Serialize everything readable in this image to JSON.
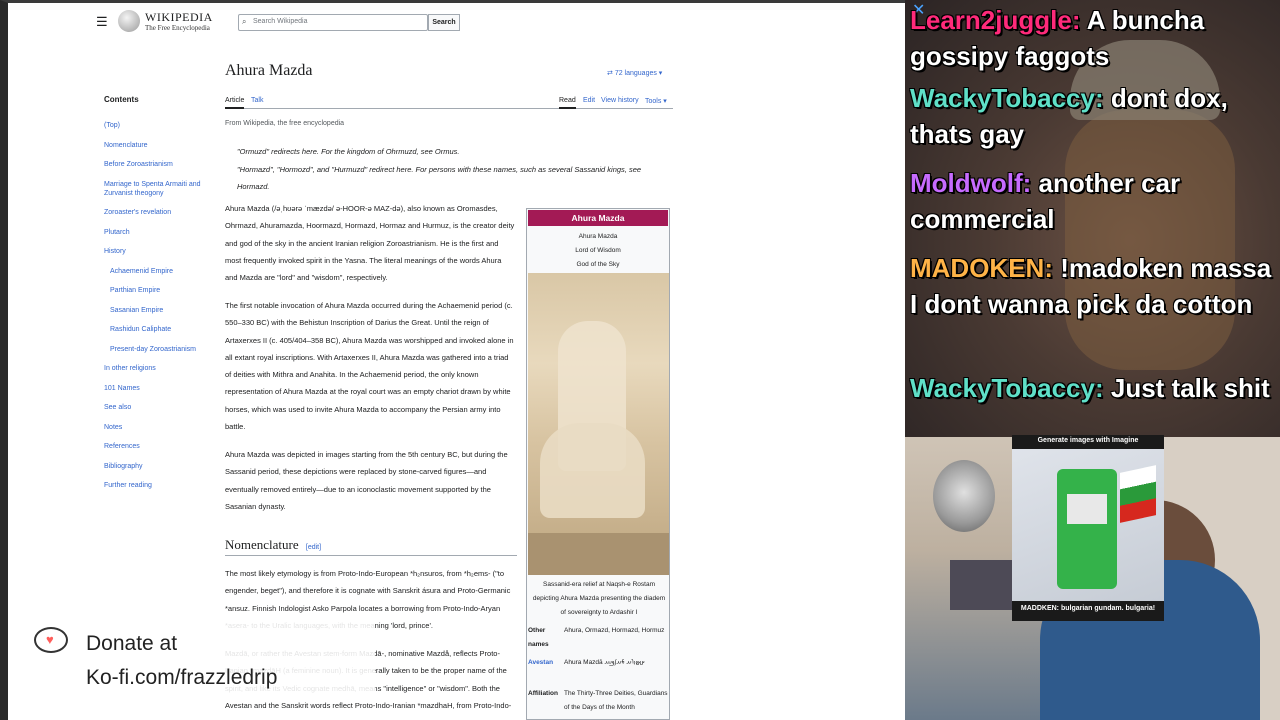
{
  "wiki": {
    "wordmark": "WIKIPEDIA",
    "tagline": "The Free Encyclopedia",
    "search_placeholder": "Search Wikipedia",
    "search_button": "Search",
    "title": "Ahura Mazda",
    "languages": "72 languages",
    "tabs": {
      "article": "Article",
      "talk": "Talk",
      "read": "Read",
      "edit": "Edit",
      "history": "View history",
      "tools": "Tools"
    },
    "from": "From Wikipedia, the free encyclopedia",
    "hatnote1": "\"Ormuzd\" redirects here. For the kingdom of Ohrmuzd, see Ormus.",
    "hatnote2": "\"Hormazd\", \"Hormozd\", and \"Hurmuzd\" redirect here. For persons with these names, such as several Sassanid kings, see Hormazd.",
    "toc_title": "Contents",
    "toc": [
      {
        "label": "(Top)",
        "sub": false
      },
      {
        "label": "Nomenclature",
        "sub": false
      },
      {
        "label": "Before Zoroastrianism",
        "sub": false
      },
      {
        "label": "Marriage to Spenta Armaiti and Zurvanist theogony",
        "sub": false
      },
      {
        "label": "Zoroaster's revelation",
        "sub": false
      },
      {
        "label": "Plutarch",
        "sub": false
      },
      {
        "label": "History",
        "sub": false
      },
      {
        "label": "Achaemenid Empire",
        "sub": true
      },
      {
        "label": "Parthian Empire",
        "sub": true
      },
      {
        "label": "Sasanian Empire",
        "sub": true
      },
      {
        "label": "Rashidun Caliphate",
        "sub": true
      },
      {
        "label": "Present-day Zoroastrianism",
        "sub": true
      },
      {
        "label": "In other religions",
        "sub": false
      },
      {
        "label": "101 Names",
        "sub": false
      },
      {
        "label": "See also",
        "sub": false
      },
      {
        "label": "Notes",
        "sub": false
      },
      {
        "label": "References",
        "sub": false
      },
      {
        "label": "Bibliography",
        "sub": false
      },
      {
        "label": "Further reading",
        "sub": false
      }
    ],
    "p1": "Ahura Mazda (/əˌhʊərə ˈmæzdə/ ə-HOOR-ə MAZ-də), also known as Oromasdes, Ohrmazd, Ahuramazda, Hoormazd, Hormazd, Hormaz and Hurmuz, is the creator deity and god of the sky in the ancient Iranian religion Zoroastrianism. He is the first and most frequently invoked spirit in the Yasna. The literal meanings of the words Ahura and Mazda are \"lord\" and \"wisdom\", respectively.",
    "p2": "The first notable invocation of Ahura Mazda occurred during the Achaemenid period (c. 550–330 BC) with the Behistun Inscription of Darius the Great. Until the reign of Artaxerxes II (c. 405/404–358 BC), Ahura Mazda was worshipped and invoked alone in all extant royal inscriptions. With Artaxerxes II, Ahura Mazda was gathered into a triad of deities with Mithra and Anahita. In the Achaemenid period, the only known representation of Ahura Mazda at the royal court was an empty chariot drawn by white horses, which was used to invite Ahura Mazda to accompany the Persian army into battle.",
    "p3": "Ahura Mazda was depicted in images starting from the 5th century BC, but during the Sassanid period, these depictions were replaced by stone-carved figures—and eventually removed entirely—due to an iconoclastic movement supported by the Sasanian dynasty.",
    "section": "Nomenclature",
    "edit": "[edit]",
    "p4": "The most likely etymology is from Proto-Indo-European *h₂nsuros, from *h₂ems- (\"to engender, beget\"), and therefore it is cognate with Sanskrit ásura and Proto-Germanic *ansuz. Finnish Indologist Asko Parpola locates a borrowing from Proto-Indo-Aryan *asera- to the Uralic languages, with the meaning 'lord, prince'.",
    "p5": "Mazdā, or rather the Avestan stem-form Mazdā-, nominative Mazdå, reflects Proto-Iranian *mazdāH (a feminine noun). It is generally taken to be the proper name of the spirit, and like its Vedic cognate medhā, means \"intelligence\" or \"wisdom\". Both the Avestan and the Sanskrit words reflect Proto-Indo-Iranian *mazdhaH, from Proto-Indo-",
    "infobox": {
      "title": "Ahura Mazda",
      "sub1": "Ahura Mazda",
      "sub2": "Lord of Wisdom",
      "sub3": "God of the Sky",
      "caption": "Sassanid-era relief at Naqsh-e Rostam depicting Ahura Mazda presenting the diadem of sovereignty to Ardashir I",
      "other_names_label": "Other names",
      "other_names": "Ahura, Ormazd, Hormazd, Hormuz",
      "avestan_label": "Avestan",
      "avestan": "Ahura Mazdā 𐬀𐬵𐬎𐬭𐬀 𐬨𐬀𐬰𐬛𐬁",
      "affiliation_label": "Affiliation",
      "affiliation": "The Thirty-Three Deities, Guardians of the Days of the Month"
    }
  },
  "donate": {
    "line1": "Donate at",
    "line2": "Ko-fi.com/frazzledrip"
  },
  "chat": [
    {
      "user": "Learn2juggle:",
      "text": " A buncha gossipy faggots",
      "color": "#ff2a7a"
    },
    {
      "user": "WackyTobaccy:",
      "text": " dont dox, thats gay",
      "color": "#5fe0c8"
    },
    {
      "user": "Moldwolf:",
      "text": " another car commercial",
      "color": "#c76bff"
    },
    {
      "user": "MADOKEN:",
      "text": " !madoken massa I dont wanna pick da cotton",
      "color": "#ffb347"
    },
    {
      "user": "WackyTobaccy:",
      "text": " Just talk shit",
      "color": "#5fe0c8"
    }
  ],
  "cam": {
    "card_title": "Generate images with Imagine",
    "card_caption": "MADDKEN: bulgarian gundam. bulgaria!"
  }
}
